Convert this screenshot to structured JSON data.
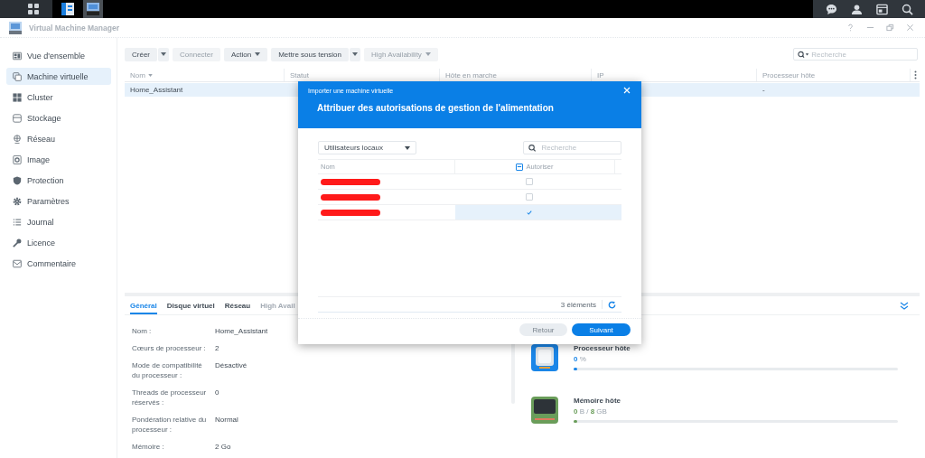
{
  "window": {
    "title": "Virtual Machine Manager"
  },
  "sidebar": {
    "items": [
      {
        "label": "Vue d'ensemble",
        "selected": false
      },
      {
        "label": "Machine virtuelle",
        "selected": true
      },
      {
        "label": "Cluster",
        "selected": false
      },
      {
        "label": "Stockage",
        "selected": false
      },
      {
        "label": "Réseau",
        "selected": false
      },
      {
        "label": "Image",
        "selected": false
      },
      {
        "label": "Protection",
        "selected": false
      },
      {
        "label": "Paramètres",
        "selected": false
      },
      {
        "label": "Journal",
        "selected": false
      },
      {
        "label": "Licence",
        "selected": false
      },
      {
        "label": "Commentaire",
        "selected": false
      }
    ]
  },
  "toolbar": [
    {
      "label": "Créer",
      "kind": "split",
      "disabled": false
    },
    {
      "label": "Connecter",
      "kind": "plain",
      "disabled": true
    },
    {
      "label": "Action",
      "kind": "menu",
      "disabled": false
    },
    {
      "label": "Mettre sous tension",
      "kind": "split",
      "disabled": false
    },
    {
      "label": "High Availability",
      "kind": "menu",
      "disabled": true
    }
  ],
  "search": {
    "placeholder": "Recherche"
  },
  "table": {
    "columns": [
      {
        "label": "Nom",
        "sorted": true
      },
      {
        "label": "Statut",
        "sorted": false
      },
      {
        "label": "Hôte en marche",
        "sorted": false
      },
      {
        "label": "IP",
        "sorted": false
      },
      {
        "label": "Processeur hôte",
        "sorted": false
      }
    ],
    "rows": [
      {
        "name": "Home_Assistant",
        "host_cpu": "-",
        "selected": true
      }
    ]
  },
  "detail_tabs": [
    {
      "label": "Général",
      "selected": true,
      "disabled": false
    },
    {
      "label": "Disque virtuel",
      "selected": false,
      "disabled": false
    },
    {
      "label": "Réseau",
      "selected": false,
      "disabled": false
    },
    {
      "label": "High Avail",
      "selected": false,
      "disabled": true
    }
  ],
  "details": [
    {
      "label": "Nom :",
      "value": "Home_Assistant"
    },
    {
      "label": "Cœurs de processeur :",
      "value": "2"
    },
    {
      "label": "Mode de compatibilité du processeur :",
      "value": "Désactivé"
    },
    {
      "label": "Threads de processeur réservés :",
      "value": "0"
    },
    {
      "label": "Pondération relative du processeur :",
      "value": "Normal"
    },
    {
      "label": "Mémoire :",
      "value": "2 Go"
    }
  ],
  "resources": [
    {
      "kind": "cpu",
      "title": "Processeur hôte",
      "reading": "**0** %",
      "color": "#1a86e8",
      "level": 0.01
    },
    {
      "kind": "memory",
      "title": "Mémoire hôte",
      "reading": "**0** B / **8** GB",
      "color": "#6a9d5a",
      "level": 0.005
    }
  ],
  "dialog": {
    "subtitle": "Importer une machine virtuelle",
    "title": "Attribuer des autorisations de gestion de l'alimentation",
    "filter": "Utilisateurs locaux",
    "search_placeholder": "Recherche",
    "columns": [
      "Nom",
      "Autoriser"
    ],
    "header_checkbox": {
      "indeterminate": true
    },
    "users": [
      {
        "allowed": false,
        "selected": false
      },
      {
        "allowed": false,
        "selected": false
      },
      {
        "allowed": true,
        "selected": true
      }
    ],
    "count": "3 éléments",
    "buttons": [
      {
        "label": "Retour",
        "kind": "secondary"
      },
      {
        "label": "Suivant",
        "kind": "primary"
      }
    ]
  }
}
